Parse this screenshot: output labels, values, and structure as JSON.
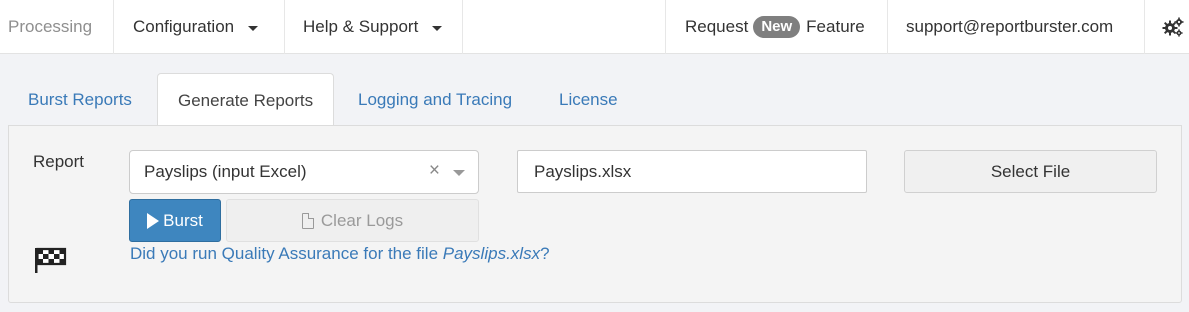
{
  "navbar": {
    "processing": "Processing",
    "configuration": "Configuration",
    "help_support": "Help & Support",
    "request_label": "Request",
    "new_badge": "New",
    "feature_label": "Feature",
    "email": "support@reportburster.com",
    "settings_icon": "gears-icon"
  },
  "tabs": [
    {
      "label": "Burst Reports",
      "active": false
    },
    {
      "label": "Generate Reports",
      "active": true
    },
    {
      "label": "Logging and Tracing",
      "active": false
    },
    {
      "label": "License",
      "active": false
    }
  ],
  "form": {
    "report_label": "Report",
    "report_selected": "Payslips (input Excel)",
    "clear_symbol": "×",
    "file_value": "Payslips.xlsx",
    "select_file_label": "Select File",
    "burst_label": "Burst",
    "clear_logs_label": "Clear Logs",
    "qa_prefix": "Did you run Quality Assurance for the file ",
    "qa_file": "Payslips.xlsx",
    "qa_suffix": "?"
  },
  "colors": {
    "link": "#3a7ab8",
    "primary_button": "#3e86bf",
    "badge": "#7f7f7f"
  }
}
